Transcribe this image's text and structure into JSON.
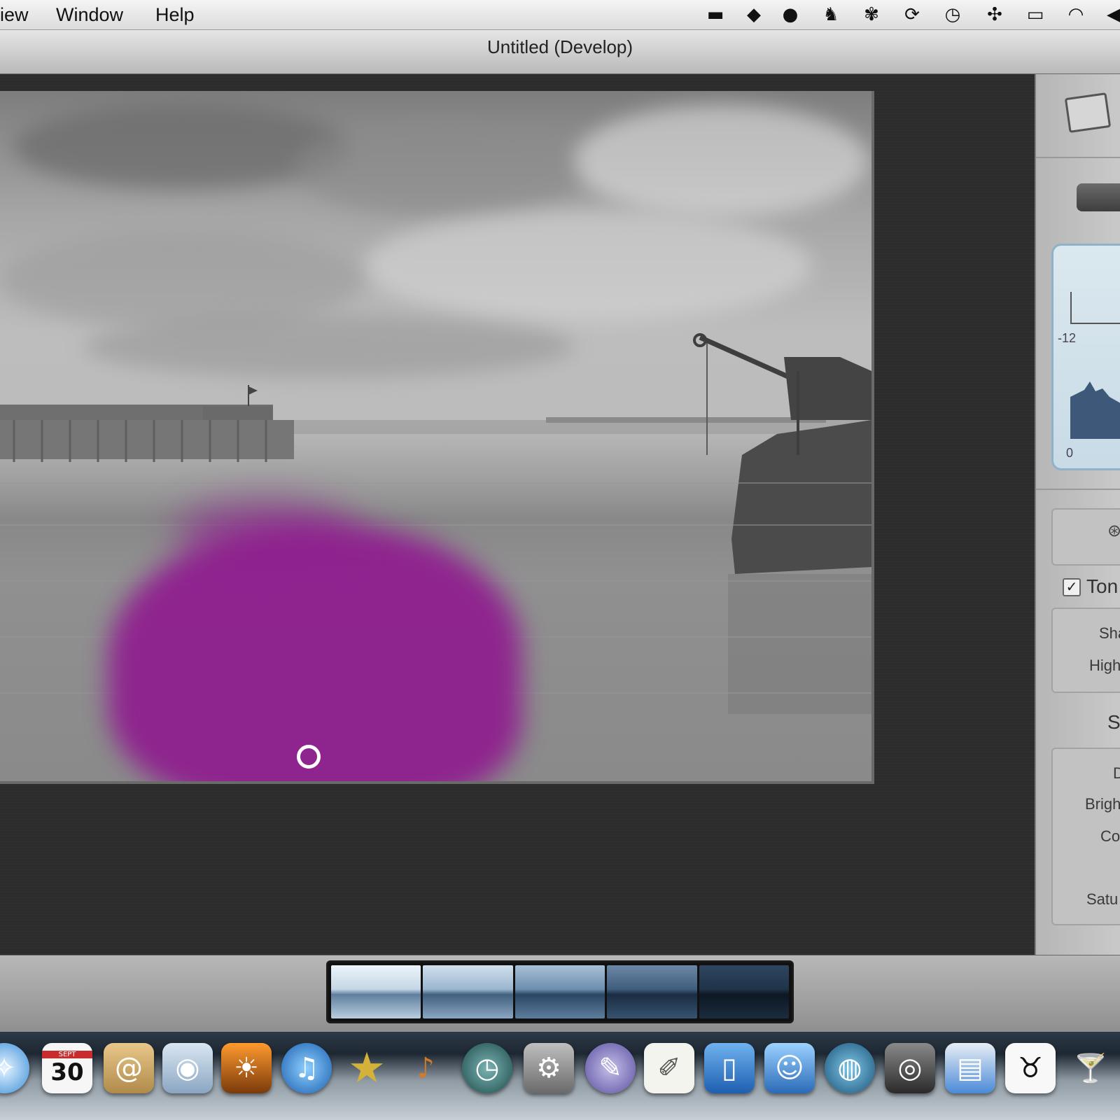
{
  "menubar": {
    "items": [
      "iew",
      "Window",
      "Help"
    ],
    "tray_icons": [
      "folder-cloud-icon",
      "dropbox-icon",
      "pen-circle-icon",
      "evernote-icon",
      "paw-icon",
      "sync-icon",
      "time-machine-icon",
      "bluetooth-icon",
      "display-icon",
      "wifi-icon",
      "volume-icon"
    ]
  },
  "window": {
    "title": "Untitled (Develop)"
  },
  "panel": {
    "histogram": {
      "left_top_label": "-12",
      "bottom_label": "0"
    },
    "tone_label": "Ton",
    "tone_checked": true,
    "rows_1": [
      "Sha",
      "High"
    ],
    "section_label": "S",
    "rows_2": [
      "D",
      "Brigh",
      "Co",
      "Satu"
    ]
  },
  "filmstrip": {
    "frames": [
      {
        "name": "frame-1",
        "brightness": "very-light"
      },
      {
        "name": "frame-2",
        "brightness": "light"
      },
      {
        "name": "frame-3",
        "brightness": "medium"
      },
      {
        "name": "frame-4",
        "brightness": "dark"
      },
      {
        "name": "frame-5",
        "brightness": "very-dark"
      }
    ]
  },
  "dock": {
    "items": [
      "safari-icon",
      "calendar-icon",
      "address-book-icon",
      "preview-icon",
      "photo-booth-icon",
      "itunes-icon",
      "imovie-icon",
      "garageband-icon",
      "time-machine-icon",
      "system-preferences-icon",
      "script-editor-icon",
      "textedit-icon",
      "xcode-icon",
      "front-row-icon",
      "network-globe-icon",
      "aperture-icon",
      "image-capture-icon",
      "cow-app-icon",
      "cocktail-icon"
    ],
    "calendar_month": "SEPT",
    "calendar_day": "30"
  },
  "colors": {
    "brush_mask": "#8f1f8f",
    "histogram_fill": "#3d5878"
  }
}
